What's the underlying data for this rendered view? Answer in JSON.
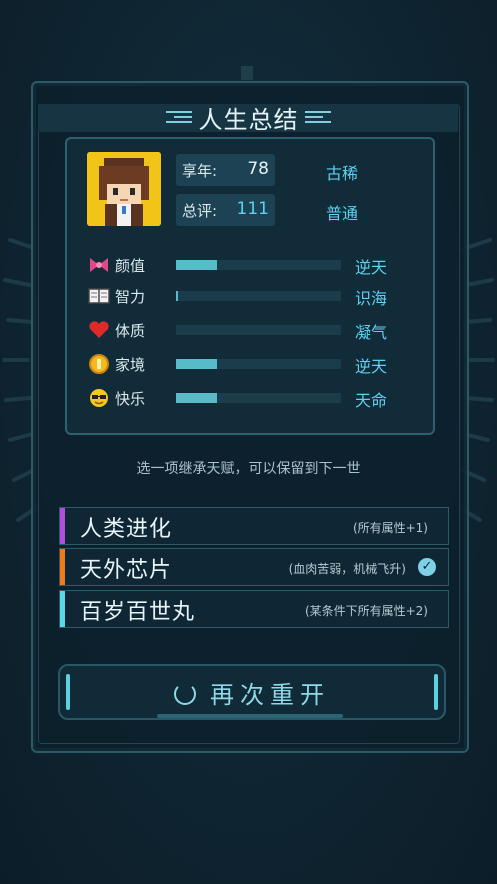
{
  "title": "人生总结",
  "profile": {
    "age_label": "享年:",
    "age_value": "78",
    "age_word": "古稀",
    "score_label": "总评:",
    "score_value": "111",
    "score_word": "普通"
  },
  "attributes": [
    {
      "icon": "bow-icon",
      "name": "颜值",
      "level": 0.25,
      "grade": "逆天"
    },
    {
      "icon": "book-icon",
      "name": "智力",
      "level": 0.01,
      "grade": "识海"
    },
    {
      "icon": "heart-icon",
      "name": "体质",
      "level": 0.0,
      "grade": "凝气"
    },
    {
      "icon": "coin-icon",
      "name": "家境",
      "level": 0.25,
      "grade": "逆天"
    },
    {
      "icon": "sunglasses-face-icon",
      "name": "快乐",
      "level": 0.25,
      "grade": "天命"
    }
  ],
  "hint": "选一项继承天赋，可以保留到下一世",
  "talents": [
    {
      "name": "人类进化",
      "desc": "(所有属性+1)",
      "color": "#b04ee0",
      "selected": false
    },
    {
      "name": "天外芯片",
      "desc": "(血肉苦弱，机械飞升)",
      "color": "#f07a18",
      "selected": true
    },
    {
      "name": "百岁百世丸",
      "desc": "(某条件下所有属性+2)",
      "color": "#58d8e8",
      "selected": false
    }
  ],
  "restart_label": "再次重开"
}
